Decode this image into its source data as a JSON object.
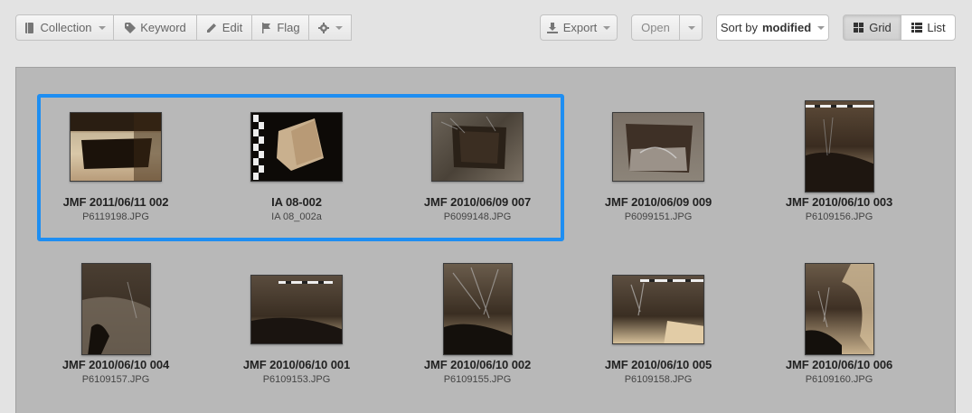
{
  "toolbar": {
    "collection_label": "Collection",
    "keyword_label": "Keyword",
    "edit_label": "Edit",
    "flag_label": "Flag",
    "export_label": "Export",
    "open_label": "Open",
    "sort_prefix": "Sort by",
    "sort_value": "modified",
    "grid_label": "Grid",
    "list_label": "List"
  },
  "colors": {
    "selection": "#1e8ef2",
    "panel": "#b8b8b8"
  },
  "items": [
    {
      "title": "JMF 2011/06/11 002",
      "file": "P6119198.JPG",
      "selected": true
    },
    {
      "title": "IA 08-002",
      "file": "IA 08_002a",
      "selected": true
    },
    {
      "title": "JMF 2010/06/09 007",
      "file": "P6099148.JPG",
      "selected": true
    },
    {
      "title": "JMF 2010/06/09 009",
      "file": "P6099151.JPG",
      "selected": false
    },
    {
      "title": "JMF 2010/06/10 003",
      "file": "P6109156.JPG",
      "selected": false
    },
    {
      "title": "JMF 2010/06/10 004",
      "file": "P6109157.JPG",
      "selected": false
    },
    {
      "title": "JMF 2010/06/10 001",
      "file": "P6109153.JPG",
      "selected": false
    },
    {
      "title": "JMF 2010/06/10 002",
      "file": "P6109155.JPG",
      "selected": false
    },
    {
      "title": "JMF 2010/06/10 005",
      "file": "P6109158.JPG",
      "selected": false
    },
    {
      "title": "JMF 2010/06/10 006",
      "file": "P6109160.JPG",
      "selected": false
    }
  ]
}
